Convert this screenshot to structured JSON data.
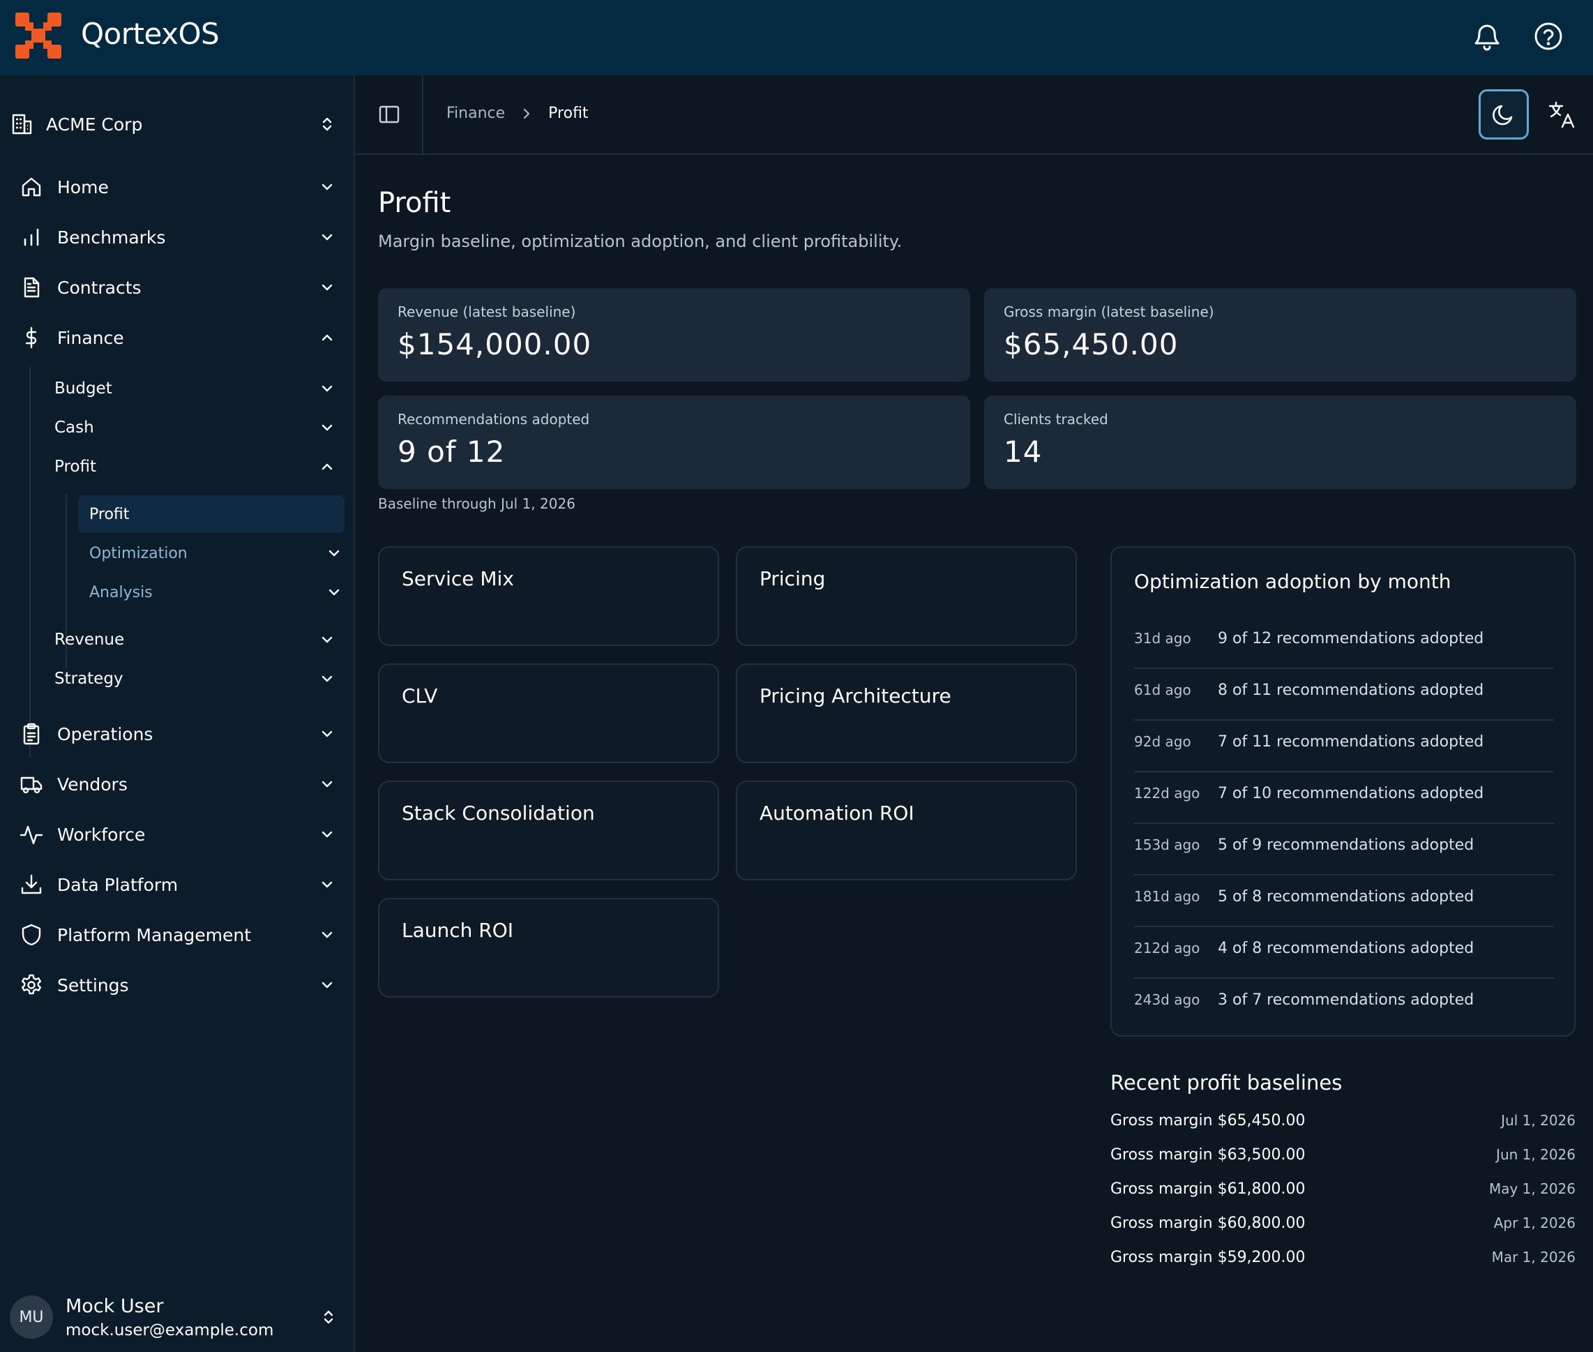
{
  "app": {
    "title": "QortexOS"
  },
  "org": {
    "name": "ACME Corp"
  },
  "nav": {
    "home": "Home",
    "benchmarks": "Benchmarks",
    "contracts": "Contracts",
    "finance": "Finance",
    "finance_children": {
      "budget": "Budget",
      "cash": "Cash",
      "profit": "Profit",
      "profit_children": {
        "profit": "Profit",
        "optimization": "Optimization",
        "analysis": "Analysis"
      },
      "revenue": "Revenue",
      "strategy": "Strategy"
    },
    "operations": "Operations",
    "vendors": "Vendors",
    "workforce": "Workforce",
    "data_platform": "Data Platform",
    "platform_management": "Platform Management",
    "settings": "Settings"
  },
  "user": {
    "initials": "MU",
    "name": "Mock User",
    "email": "mock.user@example.com"
  },
  "breadcrumb": {
    "parent": "Finance",
    "current": "Profit"
  },
  "page": {
    "title": "Profit",
    "subtitle": "Margin baseline, optimization adoption, and client profitability."
  },
  "stats": [
    {
      "label": "Revenue (latest baseline)",
      "value": "$154,000.00"
    },
    {
      "label": "Gross margin (latest baseline)",
      "value": "$65,450.00"
    },
    {
      "label": "Recommendations adopted",
      "value": "9 of 12"
    },
    {
      "label": "Clients tracked",
      "value": "14"
    }
  ],
  "baseline_note": "Baseline through Jul 1, 2026",
  "tiles": [
    "Service Mix",
    "Pricing",
    "CLV",
    "Pricing Architecture",
    "Stack Consolidation",
    "Automation ROI",
    "Launch ROI"
  ],
  "adoption": {
    "title": "Optimization adoption by month",
    "rows": [
      {
        "age": "31d ago",
        "text": "9 of 12 recommendations adopted"
      },
      {
        "age": "61d ago",
        "text": "8 of 11 recommendations adopted"
      },
      {
        "age": "92d ago",
        "text": "7 of 11 recommendations adopted"
      },
      {
        "age": "122d ago",
        "text": "7 of 10 recommendations adopted"
      },
      {
        "age": "153d ago",
        "text": "5 of 9 recommendations adopted"
      },
      {
        "age": "181d ago",
        "text": "5 of 8 recommendations adopted"
      },
      {
        "age": "212d ago",
        "text": "4 of 8 recommendations adopted"
      },
      {
        "age": "243d ago",
        "text": "3 of 7 recommendations adopted"
      }
    ]
  },
  "recent": {
    "title": "Recent profit baselines",
    "rows": [
      {
        "amount": "Gross margin $65,450.00",
        "date": "Jul 1, 2026"
      },
      {
        "amount": "Gross margin $63,500.00",
        "date": "Jun 1, 2026"
      },
      {
        "amount": "Gross margin $61,800.00",
        "date": "May 1, 2026"
      },
      {
        "amount": "Gross margin $60,800.00",
        "date": "Apr 1, 2026"
      },
      {
        "amount": "Gross margin $59,200.00",
        "date": "Mar 1, 2026"
      }
    ]
  },
  "icons": {
    "logo": "qortex-logo-icon",
    "bell": "bell-icon",
    "help": "help-circle-icon",
    "theme": "moon-icon",
    "translate": "translate-icon"
  },
  "colors": {
    "topbar": "#032a40",
    "sidebar": "#0d1c2b",
    "background": "#0c1722",
    "accent": "#f05a22",
    "card": "#1b2938",
    "active_nav": "#0f2a43",
    "focus_ring": "#5ea9d8"
  }
}
